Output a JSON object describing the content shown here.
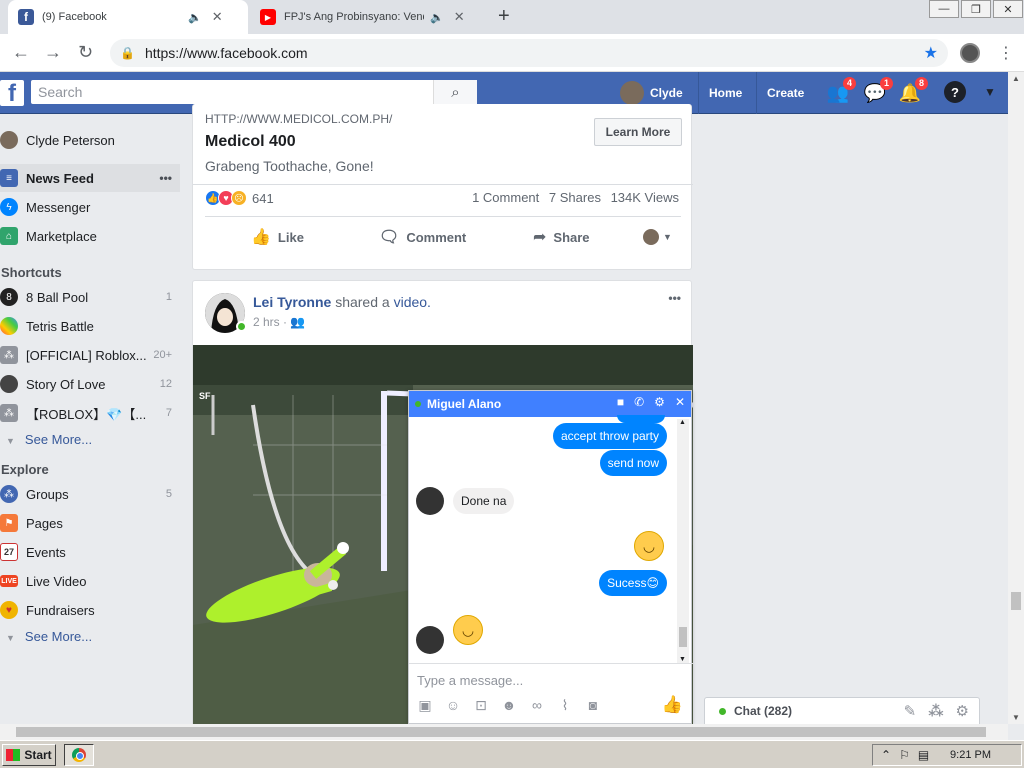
{
  "browser": {
    "tabs": [
      {
        "title": "(9) Facebook",
        "active": true
      },
      {
        "title": "FPJ's Ang Probinsyano: Vendetta",
        "active": false
      }
    ],
    "url": "https://www.facebook.com"
  },
  "header": {
    "logo": "f",
    "search_placeholder": "Search",
    "user_name": "Clyde",
    "home": "Home",
    "create": "Create",
    "badges": {
      "friends": "4",
      "messages": "1",
      "notifications": "8"
    },
    "help": "?"
  },
  "leftnav": {
    "profile": "Clyde Peterson",
    "main_items": [
      {
        "label": "News Feed",
        "icon": "newsfeed-icon",
        "color": "#4267b2"
      },
      {
        "label": "Messenger",
        "icon": "messenger-icon",
        "color": "#0084ff"
      },
      {
        "label": "Marketplace",
        "icon": "marketplace-icon",
        "color": "#30a46c"
      }
    ],
    "more_dots": "•••",
    "shortcuts_title": "Shortcuts",
    "shortcuts": [
      {
        "label": "8 Ball Pool",
        "count": "1"
      },
      {
        "label": "Tetris Battle",
        "count": ""
      },
      {
        "label": "[OFFICIAL] Roblox...",
        "count": "20+"
      },
      {
        "label": "Story Of Love",
        "count": "12"
      },
      {
        "label": "【ROBLOX】💎【...",
        "count": "7"
      }
    ],
    "see_more": "See More...",
    "explore_title": "Explore",
    "explore": [
      {
        "label": "Groups",
        "count": "5"
      },
      {
        "label": "Pages",
        "count": ""
      },
      {
        "label": "Events",
        "count": ""
      },
      {
        "label": "Live Video",
        "count": ""
      },
      {
        "label": "Fundraisers",
        "count": ""
      }
    ],
    "events_day": "27",
    "live_badge": "LIVE"
  },
  "ad_post": {
    "link": "HTTP://WWW.MEDICOL.COM.PH/",
    "title": "Medicol 400",
    "desc": "Grabeng Toothache, Gone!",
    "cta": "Learn More",
    "reaction_count": "641",
    "comments": "1 Comment",
    "shares": "7 Shares",
    "views": "134K Views",
    "actions": {
      "like": "Like",
      "comment": "Comment",
      "share": "Share"
    }
  },
  "video_post": {
    "author": "Lei Tyronne",
    "shared_text": " shared a ",
    "shared_link": "video.",
    "time": "2 hrs · ",
    "more": "•••",
    "overlay_text": "SF"
  },
  "chat": {
    "contact": "Miguel Alano",
    "messages": [
      {
        "text": "accept throw party",
        "from": "me"
      },
      {
        "text": "send now",
        "from": "me"
      },
      {
        "text": "Done na",
        "from": "them"
      },
      {
        "text": "Sucess😊",
        "from": "me"
      }
    ],
    "input_placeholder": "Type a message..."
  },
  "chatbar": {
    "label": "Chat (282)"
  },
  "taskbar": {
    "start": "Start",
    "clock": "9:21 PM"
  }
}
